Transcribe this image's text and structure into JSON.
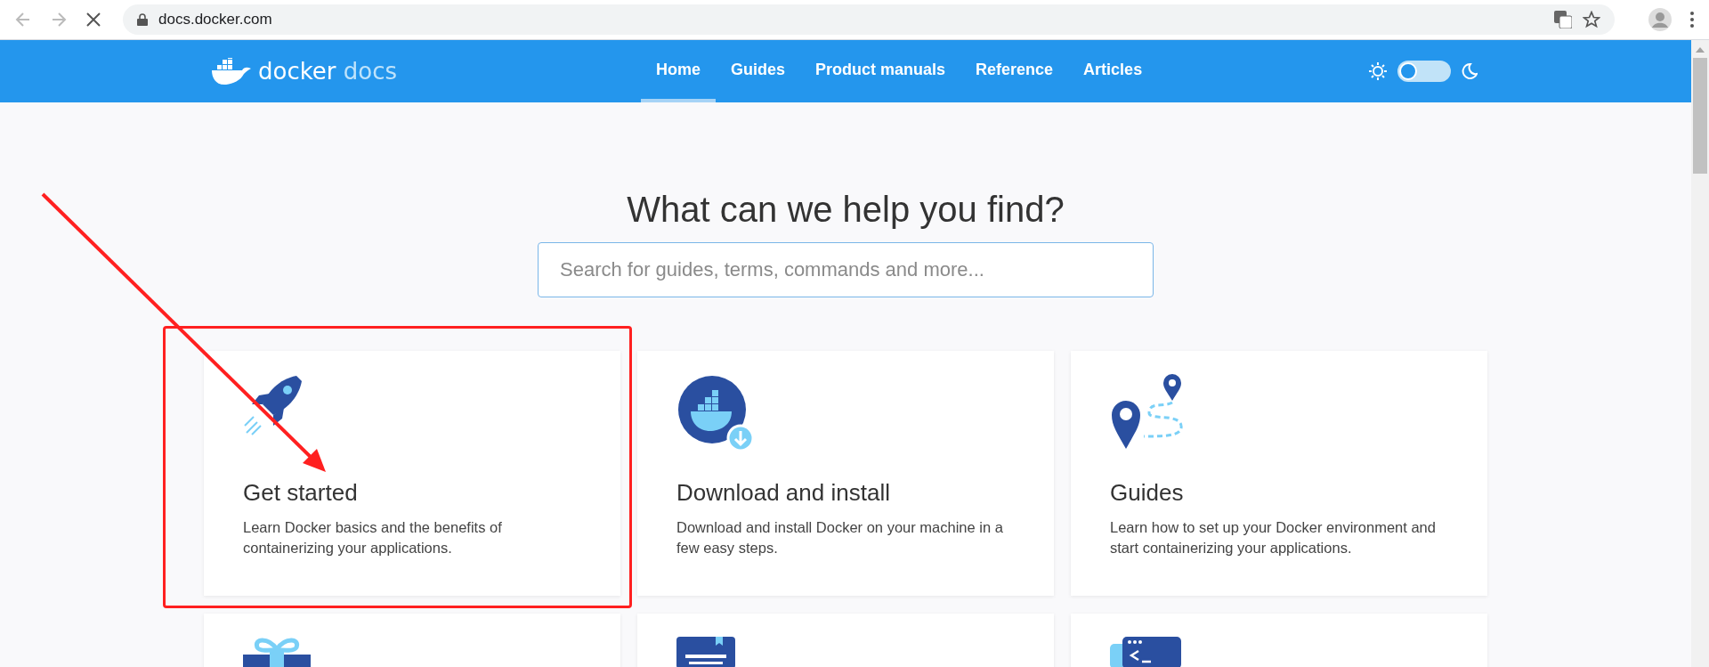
{
  "browser": {
    "url": "docs.docker.com"
  },
  "header": {
    "logo_text": "docker",
    "logo_suffix": "docs",
    "nav": [
      {
        "label": "Home",
        "selected": true
      },
      {
        "label": "Guides",
        "selected": false
      },
      {
        "label": "Product manuals",
        "selected": false
      },
      {
        "label": "Reference",
        "selected": false
      },
      {
        "label": "Articles",
        "selected": false
      }
    ],
    "dark_mode": {
      "on": false
    }
  },
  "hero": {
    "title": "What can we help you find?",
    "search": {
      "placeholder": "Search for guides, terms, commands and more..."
    }
  },
  "cards": [
    {
      "kind": "rocket",
      "title": "Get started",
      "description": "Learn Docker basics and the benefits of containerizing your applications."
    },
    {
      "kind": "download",
      "title": "Download and install",
      "description": "Download and install Docker on your machine in a few easy steps."
    },
    {
      "kind": "map",
      "title": "Guides",
      "description": "Learn how to set up your Docker environment and start containerizing your applications."
    },
    {
      "kind": "gift"
    },
    {
      "kind": "document"
    },
    {
      "kind": "terminal"
    }
  ]
}
